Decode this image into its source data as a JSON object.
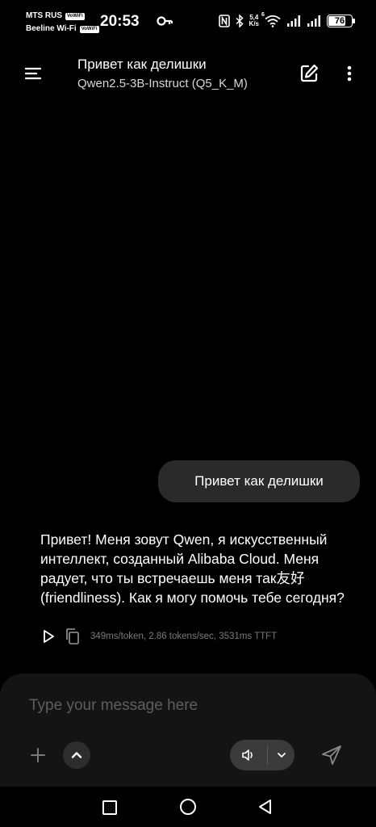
{
  "status_bar": {
    "carrier_1": "MTS RUS",
    "carrier_2": "Beeline Wi-Fi",
    "volte_badge": "VoWiFi",
    "time": "20:53",
    "speed_value": "5,4",
    "speed_unit": "K/s",
    "wifi_label": "6",
    "battery": "76",
    "battery_level": 0.76,
    "icons": [
      "key-icon",
      "nfc-icon",
      "bluetooth-icon",
      "wifi-icon",
      "signal-icon",
      "signal-icon",
      "battery-icon"
    ]
  },
  "app_bar": {
    "title": "Привет как делишки",
    "model": "Qwen2.5-3B-Instruct (Q5_K_M)",
    "icons": [
      "menu-icon",
      "edit-icon",
      "more-vertical-icon"
    ]
  },
  "messages": [
    {
      "role": "user",
      "text": "Привет как делишки"
    },
    {
      "role": "assistant",
      "text": "Привет! Меня зовут Qwen, я искусственный интеллект, созданный Alibaba Cloud. Меня радует, что ты встречаешь меня так友好 (friendliness). Как я могу помочь тебе сегодня?",
      "stats": "349ms/token, 2.86 tokens/sec, 3531ms TTFT",
      "icons": [
        "play-icon",
        "copy-icon"
      ]
    }
  ],
  "input": {
    "placeholder": "Type your message here",
    "value": "",
    "icons": [
      "plus-icon",
      "chevron-up-icon",
      "speaker-icon",
      "chevron-down-icon",
      "send-icon"
    ]
  },
  "nav_bar": {
    "icons": [
      "recents-icon",
      "home-icon",
      "back-icon"
    ]
  },
  "colors": {
    "background": "#000000",
    "user_bubble": "#2a2a2a",
    "input_panel": "#141414",
    "placeholder": "#5e5e5e",
    "stats_text": "#7a7a7a",
    "voice_pill": "#3a3a3a"
  }
}
